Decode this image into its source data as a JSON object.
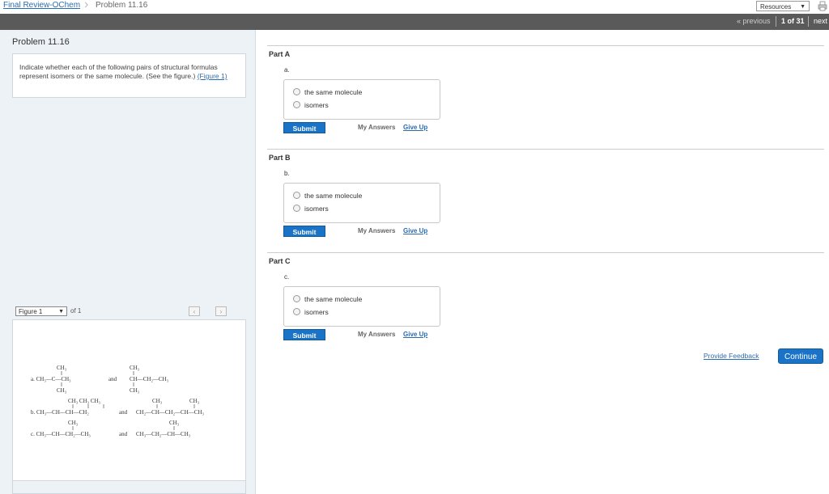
{
  "breadcrumb": {
    "parent": "Final Review-OChem",
    "current": "Problem 11.16"
  },
  "resources": {
    "label": "Resources"
  },
  "nav": {
    "previous": "« previous",
    "count": "1 of 31",
    "next": "next"
  },
  "problem": {
    "title": "Problem 11.16",
    "text": "Indicate whether each of the following pairs of structural formulas represent isomers or the same molecule. (See the figure.)",
    "figure_link": "(Figure 1)"
  },
  "figure": {
    "selected": "Figure 1",
    "of_label": "of 1",
    "prev": "‹",
    "next": "›",
    "chem": {
      "a_top1": "CH₃",
      "a_main": "a. CH₃—C—CH₃",
      "a_bot1": "CH₃",
      "a_and": "and",
      "a_top2": "CH₃",
      "a_main2": "CH—CH₂—CH₃",
      "a_bot2": "CH₃",
      "b_top1": "CH₃  CH₃  CH₃",
      "b_main": "b. CH₃—CH—CH—CH₂",
      "b_and": "and",
      "b_top2": "CH₃",
      "b_top3": "CH₃",
      "b_main2": "CH₂—CH—CH₂—CH—CH₃",
      "c_top1": "CH₃",
      "c_main": "c. CH₃—CH—CH₂—CH₃",
      "c_and": "and",
      "c_top2": "CH₃",
      "c_main2": "CH₃—CH₂—CH—CH₃"
    }
  },
  "parts": [
    {
      "title": "Part A",
      "letter": "a.",
      "options": [
        "the same molecule",
        "isomers"
      ],
      "submit": "Submit",
      "my_answers": "My Answers",
      "give_up": "Give Up"
    },
    {
      "title": "Part B",
      "letter": "b.",
      "options": [
        "the same molecule",
        "isomers"
      ],
      "submit": "Submit",
      "my_answers": "My Answers",
      "give_up": "Give Up"
    },
    {
      "title": "Part C",
      "letter": "c.",
      "options": [
        "the same molecule",
        "isomers"
      ],
      "submit": "Submit",
      "my_answers": "My Answers",
      "give_up": "Give Up"
    }
  ],
  "footer": {
    "feedback": "Provide Feedback",
    "continue": "Continue"
  },
  "colors": {
    "accent": "#1a73c7",
    "link": "#2b6cb0",
    "navbar": "#5a5a5a",
    "panel": "#edf2f7"
  }
}
